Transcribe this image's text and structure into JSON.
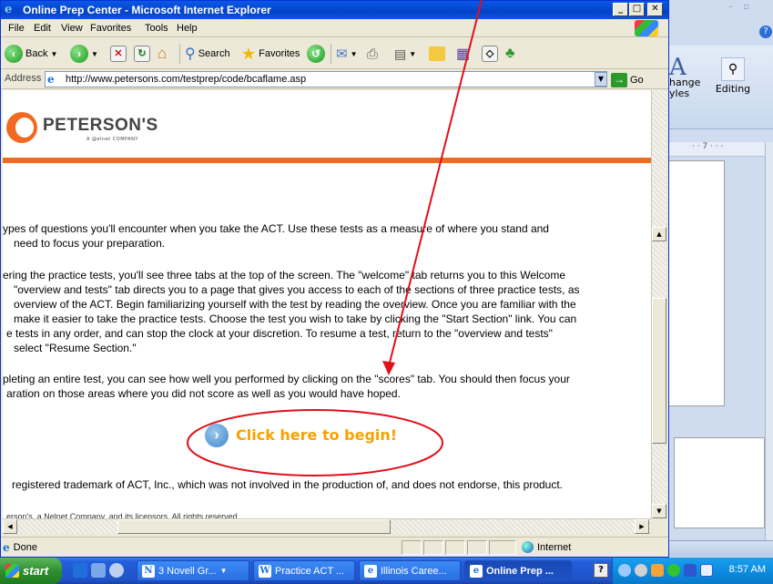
{
  "browser": {
    "title": "Online Prep Center - Microsoft Internet Explorer",
    "menu": [
      "File",
      "Edit",
      "View",
      "Favorites",
      "Tools",
      "Help"
    ],
    "toolbar": {
      "back": "Back",
      "search": "Search",
      "favorites": "Favorites"
    },
    "address_label": "Address",
    "url": "http://www.petersons.com/testprep/code/bcaflame.asp",
    "go": "Go",
    "status": {
      "left": "Done",
      "zone": "Internet"
    }
  },
  "page": {
    "logo": "PETERSON'S",
    "logo_sub": "A @elnet COMPANY",
    "paragraphs": [
      [
        "ypes of questions you'll encounter when you take the ACT. Use these tests as a measure of where you stand and",
        "need to focus your preparation."
      ],
      [
        "ering the practice tests, you'll see three tabs at the top of the screen. The \"welcome\" tab returns you to this Welcome",
        "\"overview and tests\" tab directs you to a page that gives you access to each of the sections of three practice tests, as",
        "overview of the ACT. Begin familiarizing yourself with the test by reading the overview. Once you are familiar with the",
        "make it easier to take the practice tests. Choose the test you wish to take by clicking the \"Start Section\" link. You can",
        "e tests in any order, and can stop the clock at your discretion. To resume a test, return to the \"overview and tests\"",
        "select \"Resume Section.\""
      ],
      [
        "pleting an entire test, you can see how well you performed by clicking on the \"scores\" tab. You should then focus your",
        "aration on those areas where you did not score as well as you would have hoped."
      ]
    ],
    "begin_button": "Click here to begin!",
    "trademark": "registered trademark of ACT, Inc., which was not involved in the production of, and does not endorse, this product.",
    "copyright_partial": "erson's, a Nelnet Company, and its licensors. All rights reserved."
  },
  "word": {
    "change_styles": [
      "hange",
      "yles"
    ],
    "editing": "Editing",
    "ruler_mark": "· · 7 · · ·"
  },
  "taskbar": {
    "start": "start",
    "tasks": [
      "3 Novell Gr...",
      "Practice ACT ...",
      "Illinois Caree...",
      "Online Prep ..."
    ],
    "clock": "8:57 AM"
  },
  "colors": {
    "accent": "#f26a21",
    "annotation": "#e0101a",
    "begin_text": "#f5a300"
  }
}
